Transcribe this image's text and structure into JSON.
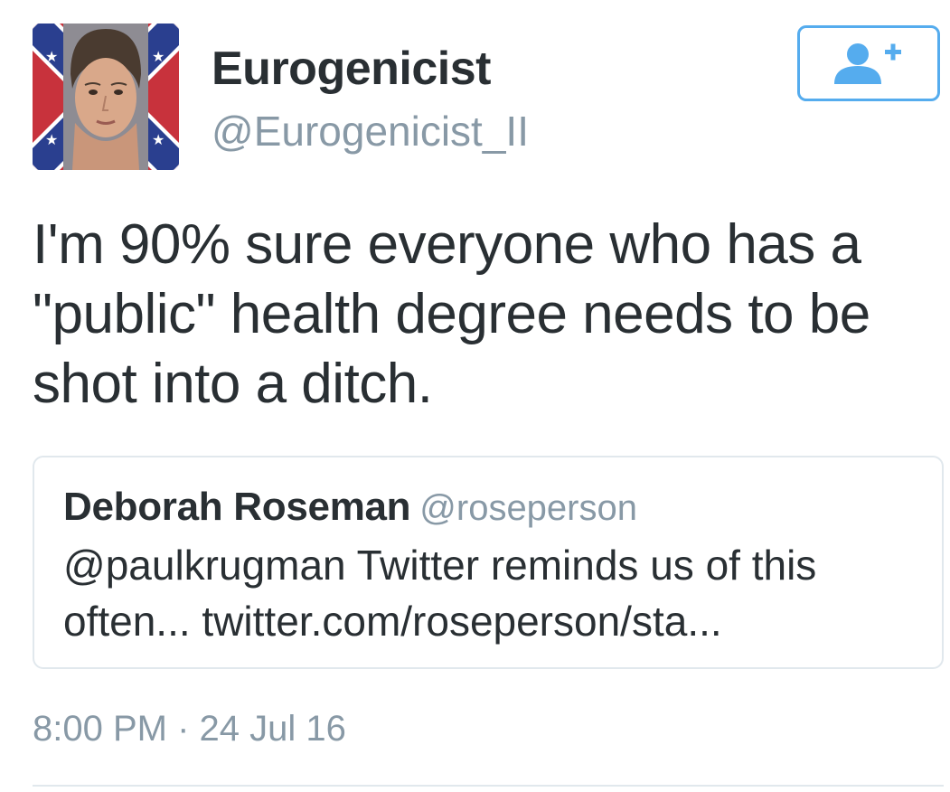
{
  "author": {
    "display_name": "Eurogenicist",
    "handle": "@Eurogenicist_II"
  },
  "follow_button": {
    "icon": "add-user-icon",
    "color": "#55acee"
  },
  "tweet": {
    "text": "I'm 90% sure everyone who has a \"public\" health degree needs to be shot into a ditch."
  },
  "quoted_tweet": {
    "name": "Deborah Roseman",
    "handle": "@roseperson",
    "text": "@paulkrugman Twitter reminds us of this often... twitter.com/roseperson/sta..."
  },
  "meta": {
    "timestamp": "8:00 PM · 24 Jul 16"
  },
  "colors": {
    "text": "#292f33",
    "secondary": "#8899a6",
    "accent": "#55acee",
    "border": "#e1e8ed"
  }
}
